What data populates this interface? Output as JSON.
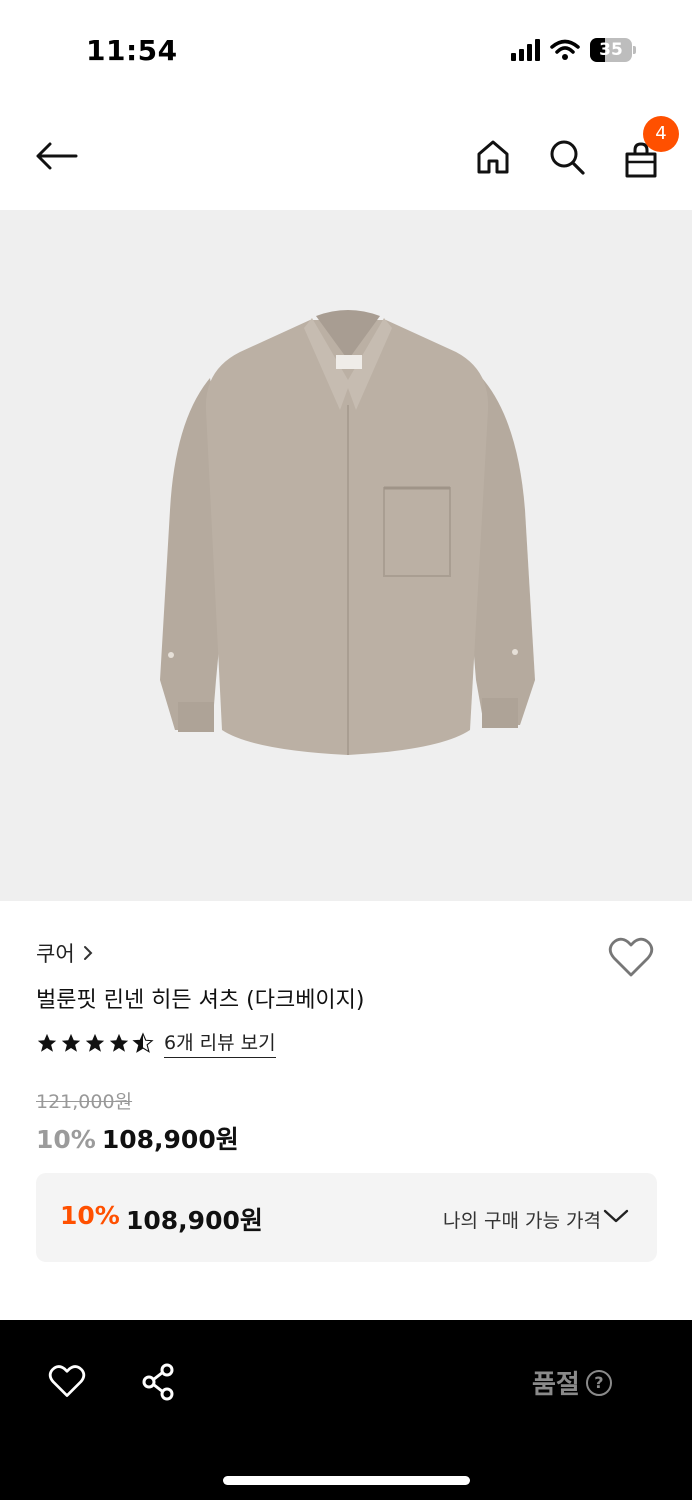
{
  "status_bar": {
    "time": "11:54",
    "battery": "35",
    "icons": [
      "signal-icon",
      "wifi-icon",
      "battery-icon"
    ]
  },
  "header": {
    "cart_count": "4",
    "icons": [
      "back-arrow-icon",
      "home-icon",
      "search-icon",
      "shopping-bag-icon"
    ]
  },
  "product": {
    "image_alt": "linen shirt dark beige",
    "brand": "쿠어",
    "name": "벌룬핏 린넨 히든 셔츠 (다크베이지)",
    "rating": 4.5,
    "review_link": "6개 리뷰 보기",
    "original_price": "121,000원",
    "discount": "10%",
    "price": "108,900원"
  },
  "my_price": {
    "discount": "10%",
    "price": "108,900원",
    "label": "나의 구매 가능 가격"
  },
  "bottom_bar": {
    "status": "품절",
    "help": "?",
    "icons": [
      "heart-icon",
      "share-icon",
      "help-icon"
    ]
  },
  "colors": {
    "accent": "#ff5000",
    "image_bg": "#efefef",
    "bottom_bar_bg": "#000000",
    "shirt": "#b9aea2"
  }
}
